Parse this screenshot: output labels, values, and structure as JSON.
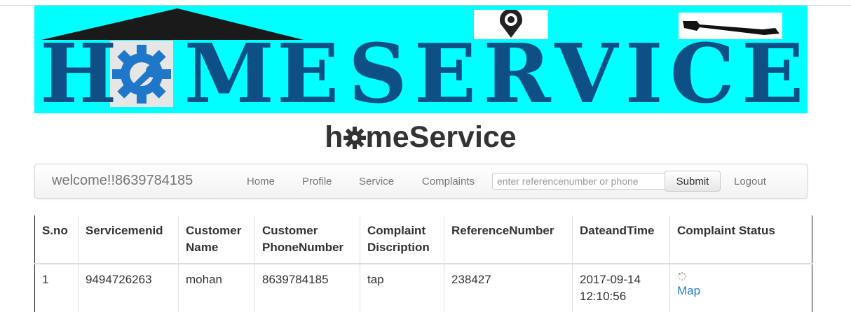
{
  "banner": {
    "word1_left": "H",
    "word1_right": "ME",
    "word2": "SERVICES",
    "colors": {
      "background": "#00ffff",
      "lettering": "#0e4f86",
      "roof": "#1a1a1a"
    }
  },
  "site_title": {
    "prefix": "h",
    "suffix": "meService"
  },
  "navbar": {
    "brand": "welcome!!8639784185",
    "links": [
      "Home",
      "Profile",
      "Service",
      "Complaints"
    ],
    "search_placeholder": "enter referencenumber or phone",
    "submit_label": "Submit",
    "logout_label": "Logout"
  },
  "table": {
    "headers": [
      [
        "S.no"
      ],
      [
        "Servicemenid"
      ],
      [
        "Customer",
        "Name"
      ],
      [
        "Customer",
        "PhoneNumber"
      ],
      [
        "Complaint",
        "Discription"
      ],
      [
        "ReferenceNumber"
      ],
      [
        "DateandTime"
      ],
      [
        "Complaint Status"
      ]
    ],
    "rows": [
      {
        "sno": "1",
        "servicemenid": "9494726263",
        "customer_name": "mohan",
        "customer_phone": "8639784185",
        "complaint_description": "tap",
        "reference_number": "238427",
        "date": "2017-09-14",
        "time": "12:10:56",
        "status_link": "Map"
      }
    ],
    "link_color": "#2a7ccf"
  }
}
